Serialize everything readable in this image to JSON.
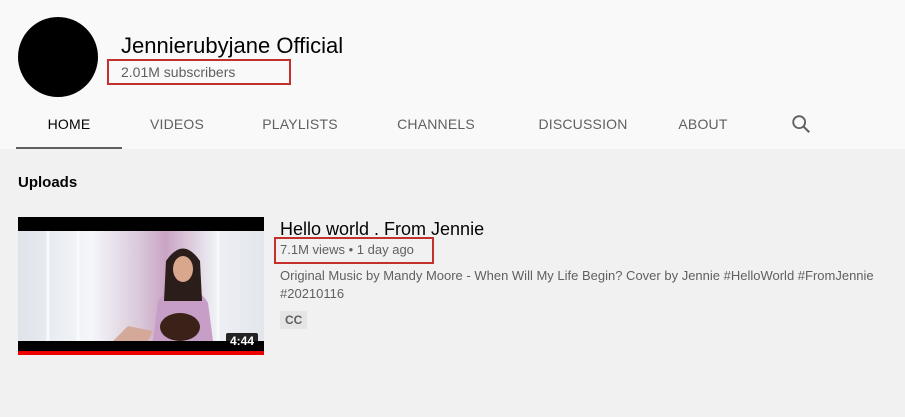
{
  "channel": {
    "name": "Jennierubyjane Official",
    "subscribers": "2.01M subscribers"
  },
  "tabs": [
    {
      "label": "HOME",
      "active": true
    },
    {
      "label": "VIDEOS",
      "active": false
    },
    {
      "label": "PLAYLISTS",
      "active": false
    },
    {
      "label": "CHANNELS",
      "active": false
    },
    {
      "label": "DISCUSSION",
      "active": false
    },
    {
      "label": "ABOUT",
      "active": false
    }
  ],
  "icons": {
    "search": "search-icon"
  },
  "uploads": {
    "section_title": "Uploads",
    "video": {
      "title": "Hello world . From Jennie",
      "meta": "7.1M views • 1 day ago",
      "description": "Original Music by Mandy Moore - When Will My Life Begin? Cover by Jennie #HelloWorld #FromJennie #20210116",
      "badge": "CC",
      "duration": "4:44"
    }
  },
  "colors": {
    "highlight_box": "#c4302b",
    "progress_bar": "#ee0000"
  }
}
